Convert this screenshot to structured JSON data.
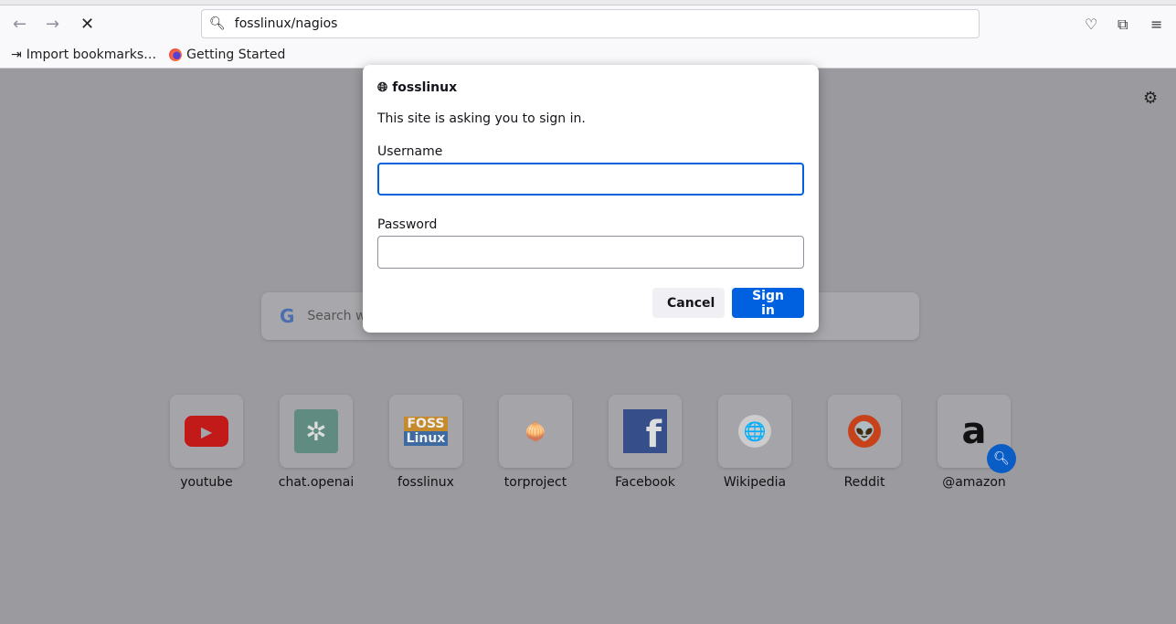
{
  "browser": {
    "url": "fosslinux/nagios",
    "bookmarks": [
      {
        "label": "Import bookmarks…",
        "icon": "import-icon"
      },
      {
        "label": "Getting Started",
        "icon": "firefox-icon"
      }
    ]
  },
  "newtab": {
    "search_placeholder": "Search w",
    "tiles": [
      {
        "label": "youtube",
        "icon_text": "▶"
      },
      {
        "label": "chat.openai",
        "icon_text": "✲"
      },
      {
        "label": "fosslinux",
        "icon_text": [
          "FOSS",
          "Linux"
        ]
      },
      {
        "label": "torproject",
        "icon_text": "🧅"
      },
      {
        "label": "Facebook",
        "icon_text": "f"
      },
      {
        "label": "Wikipedia",
        "icon_text": "🌐"
      },
      {
        "label": "Reddit",
        "icon_text": "👽"
      },
      {
        "label": "@amazon",
        "icon_text": "a"
      }
    ]
  },
  "dialog": {
    "site": "fosslinux",
    "message": "This site is asking you to sign in.",
    "username_label": "Username",
    "username_value": "",
    "password_label": "Password",
    "password_value": "",
    "cancel_label": "Cancel",
    "signin_label": "Sign in"
  },
  "colors": {
    "accent": "#0061e0",
    "overlay_bg": "#9b9a9f"
  }
}
